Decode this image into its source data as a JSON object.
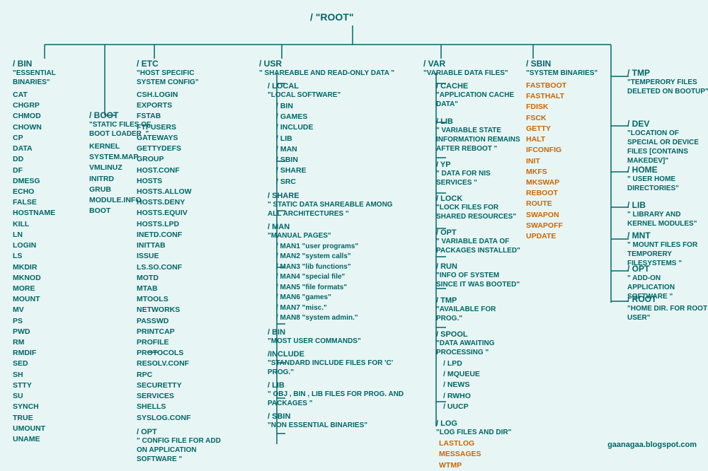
{
  "root": {
    "label": "/   \"ROOT\"",
    "bin": {
      "name": "/ BIN",
      "desc": "\"ESSENTIAL BINARIES\"",
      "files": [
        "CAT",
        "CHGRP",
        "CHMOD",
        "CHOWN",
        "CP",
        "DATA",
        "DD",
        "DF",
        "DMESG",
        "ECHO",
        "FALSE",
        "HOSTNAME",
        "KILL",
        "LN",
        "LOGIN",
        "LS",
        "MKDIR",
        "MKNOD",
        "MORE",
        "MOUNT",
        "MV",
        "PS",
        "PWD",
        "RM",
        "RMDIF",
        "SED",
        "SH",
        "STTY",
        "SU",
        "SYNCH",
        "TRUE",
        "UMOUNT",
        "UNAME"
      ]
    },
    "boot": {
      "name": "/ BOOT",
      "desc": "\"STATIC FILES OF BOOT LOADER .\"",
      "files": [
        "KERNEL",
        "SYSTEM.MAP",
        "VMLINUZ",
        "INITRD",
        "GRUB",
        "MODULE.INFO",
        "BOOT"
      ]
    },
    "etc": {
      "name": "/ ETC",
      "desc": "\"HOST SPECIFIC SYSTEM CONFIG\"",
      "files": [
        "CSH.LOGIN",
        "EXPORTS",
        "FSTAB",
        "FTPUSERS",
        "GATEWAYS",
        "GETTYDEFS",
        "GROUP",
        "HOST.CONF",
        "HOSTS",
        "HOSTS.ALLOW",
        "HOSTS.DENY",
        "HOSTS.EQUIV",
        "HOSTS.LPD",
        "INETD.CONF",
        "INITTAB",
        "ISSUE",
        "LS.SO.CONF",
        "MOTD",
        "MTAB",
        "MTOOLS",
        "NETWORKS",
        "PASSWD",
        "PRINTCAP",
        "PROFILE",
        "PROTOCOLS",
        "RESOLV.CONF",
        "RPC",
        "SECURETTY",
        "SERVICES",
        "SHELLS",
        "SYSLOG.CONF"
      ],
      "opt": {
        "name": "/ OPT",
        "desc": "\" CONFIG FILE FOR ADD ON APPLICATION SOFTWARE \""
      }
    },
    "usr": {
      "name": "/ USR",
      "desc": "\" SHAREABLE AND READ-ONLY DATA \"",
      "local": {
        "name": "/ LOCAL",
        "desc": "\"LOCAL SOFTWARE\"",
        "sub": [
          "/ BIN",
          "/ GAMES",
          "/ INCLUDE",
          "/ LIB",
          "/ MAN",
          "/ SBIN",
          "/ SHARE",
          "/ SRC"
        ]
      },
      "share": {
        "name": "/ SHARE",
        "desc": "\" STATIC DATA SHAREABLE AMONG ALL ARCHITECTURES \""
      },
      "man": {
        "name": "/ MAN",
        "desc": "\"MANUAL PAGES\"",
        "sub": [
          "/ MAN1 \"user programs\"",
          "/ MAN2 \"system calls\"",
          "/ MAN3 \"lib functions\"",
          "/ MAN4 \"special file\"",
          "/ MAN5 \"file formats\"",
          "/ MAN6 \"games\"",
          "/ MAN7 \"misc.\"",
          "/ MAN8 \"system admin.\""
        ]
      },
      "bin": {
        "name": "/ BIN",
        "desc": "\"MOST USER COMMANDS\""
      },
      "include": {
        "name": "/ INCLUDE",
        "desc": "\"STANDARD INCLUDE FILES FOR 'C' PROG.\""
      },
      "lib": {
        "name": "/ LIB",
        "desc": "\" OBJ , BIN , LIB FILES FOR PROG. AND PACKAGES \""
      },
      "sbin": {
        "name": "/ SBIN",
        "desc": "\"NON ESSENTIAL BINARIES\""
      }
    },
    "var": {
      "name": "/ VAR",
      "desc": "\"VARIABLE DATA FILES\"",
      "cache": {
        "name": "/ CACHE",
        "desc": "\"APPLICATION CACHE DATA\""
      },
      "lib": {
        "name": "/ LIB",
        "desc": "\" VARIABLE STATE INFORMATION REMAINS AFTER REBOOT \""
      },
      "yp": {
        "name": "/ YP",
        "desc": "\" DATA FOR NIS SERVICES \""
      },
      "lock": {
        "name": "/ LOCK",
        "desc": "\"LOCK FILES FOR SHARED RESOURCES\""
      },
      "opt": {
        "name": "/ OPT",
        "desc": "\" VARIABLE DATA OF PACKAGES INSTALLED\""
      },
      "run": {
        "name": "/ RUN",
        "desc": "\"INFO OF SYSTEM SINCE IT WAS BOOTED\""
      },
      "tmp": {
        "name": "/ TMP",
        "desc": "\"AVAILABLE FOR PROG.\""
      },
      "spool": {
        "name": "/ SPOOL",
        "desc": "\"DATA AWAITING PROCESSING \"",
        "sub": [
          "/ LPD",
          "/ MQUEUE",
          "/ NEWS",
          "/ RWHO",
          "/ UUCP"
        ]
      },
      "log": {
        "name": "/ LOG",
        "desc": "\"LOG FILES AND DIR\"",
        "files_orange": [
          "LASTLOG",
          "MESSAGES",
          "WTMP"
        ]
      }
    },
    "sbin": {
      "name": "/ SBIN",
      "desc": "\"SYSTEM BINARIES\"",
      "files_orange": [
        "FASTBOOT",
        "FASTHALT",
        "FDISK",
        "FSCK",
        "GETTY",
        "HALT",
        "IFCONFIG",
        "INIT",
        "MKFS",
        "MKSWAP",
        "REBOOT",
        "ROUTE",
        "SWAPON",
        "SWAPOFF",
        "UPDATE"
      ]
    },
    "tmp": {
      "name": "/ TMP",
      "desc": "\"TEMPERORY FILES DELETED ON BOOTUP\""
    },
    "dev": {
      "name": "/ DEV",
      "desc": "\"LOCATION OF SPECIAL OR DEVICE FILES [CONTAINS MAKEDEV]\""
    },
    "home": {
      "name": "/ HOME",
      "desc": "\" USER HOME DIRECTORIES\""
    },
    "lib": {
      "name": "/ LIB",
      "desc": "\"  LIBRARY AND KERNEL MODULES\""
    },
    "mnt": {
      "name": "/ MNT",
      "desc": "\"  MOUNT FILES FOR TEMPORERY FILESYSTEMS \""
    },
    "opt": {
      "name": "/ OPT",
      "desc": "\" ADD-ON APPLICATION SOFTWARE \""
    },
    "root_home": {
      "name": "/ ROOT",
      "desc": "\"HOME DIR. FOR ROOT USER\""
    },
    "system_map": "SYSTEM MAP",
    "watermark": "gaanagaa.blogspot.com"
  }
}
